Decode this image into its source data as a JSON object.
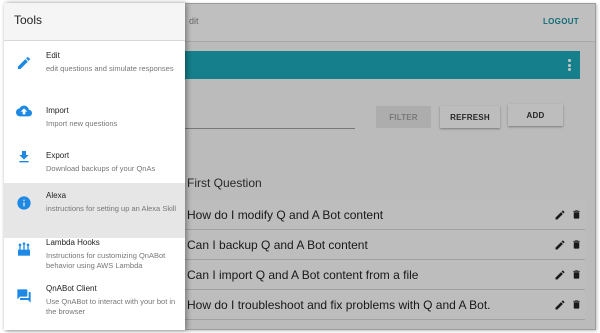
{
  "topbar": {
    "title_fragment": "dit",
    "logout_label": "LOGOUT"
  },
  "toolbar": {
    "filter_label": "FILTER",
    "refresh_label": "REFRESH",
    "add_label": "ADD"
  },
  "list": {
    "header": "First Question",
    "questions": [
      "How do I modify Q and A Bot content",
      "Can I backup Q and A Bot content",
      "Can I import Q and A Bot content from a file",
      "How do I troubleshoot and fix problems with Q and A Bot."
    ]
  },
  "drawer": {
    "title": "Tools",
    "items": [
      {
        "title": "Edit",
        "desc": "edit questions and simulate responses",
        "icon": "pencil-icon"
      },
      {
        "title": "Import",
        "desc": "Import new questions",
        "icon": "cloud-upload-icon"
      },
      {
        "title": "Export",
        "desc": "Download backups of your QnAs",
        "icon": "download-icon"
      },
      {
        "title": "Alexa",
        "desc": "instructions for setting up an Alexa Skill",
        "icon": "info-icon",
        "selected": true
      },
      {
        "title": "Lambda Hooks",
        "desc": "Instructions for customizing QnABot behavior using AWS Lambda",
        "icon": "lambda-hooks-icon"
      },
      {
        "title": "QnABot Client",
        "desc": "Use QnABot to interact with your bot in the browser",
        "icon": "chat-icon"
      }
    ]
  },
  "colors": {
    "accent": "#1ba3b3",
    "icon_blue": "#1e88e5",
    "logout": "#1a8a9a"
  }
}
